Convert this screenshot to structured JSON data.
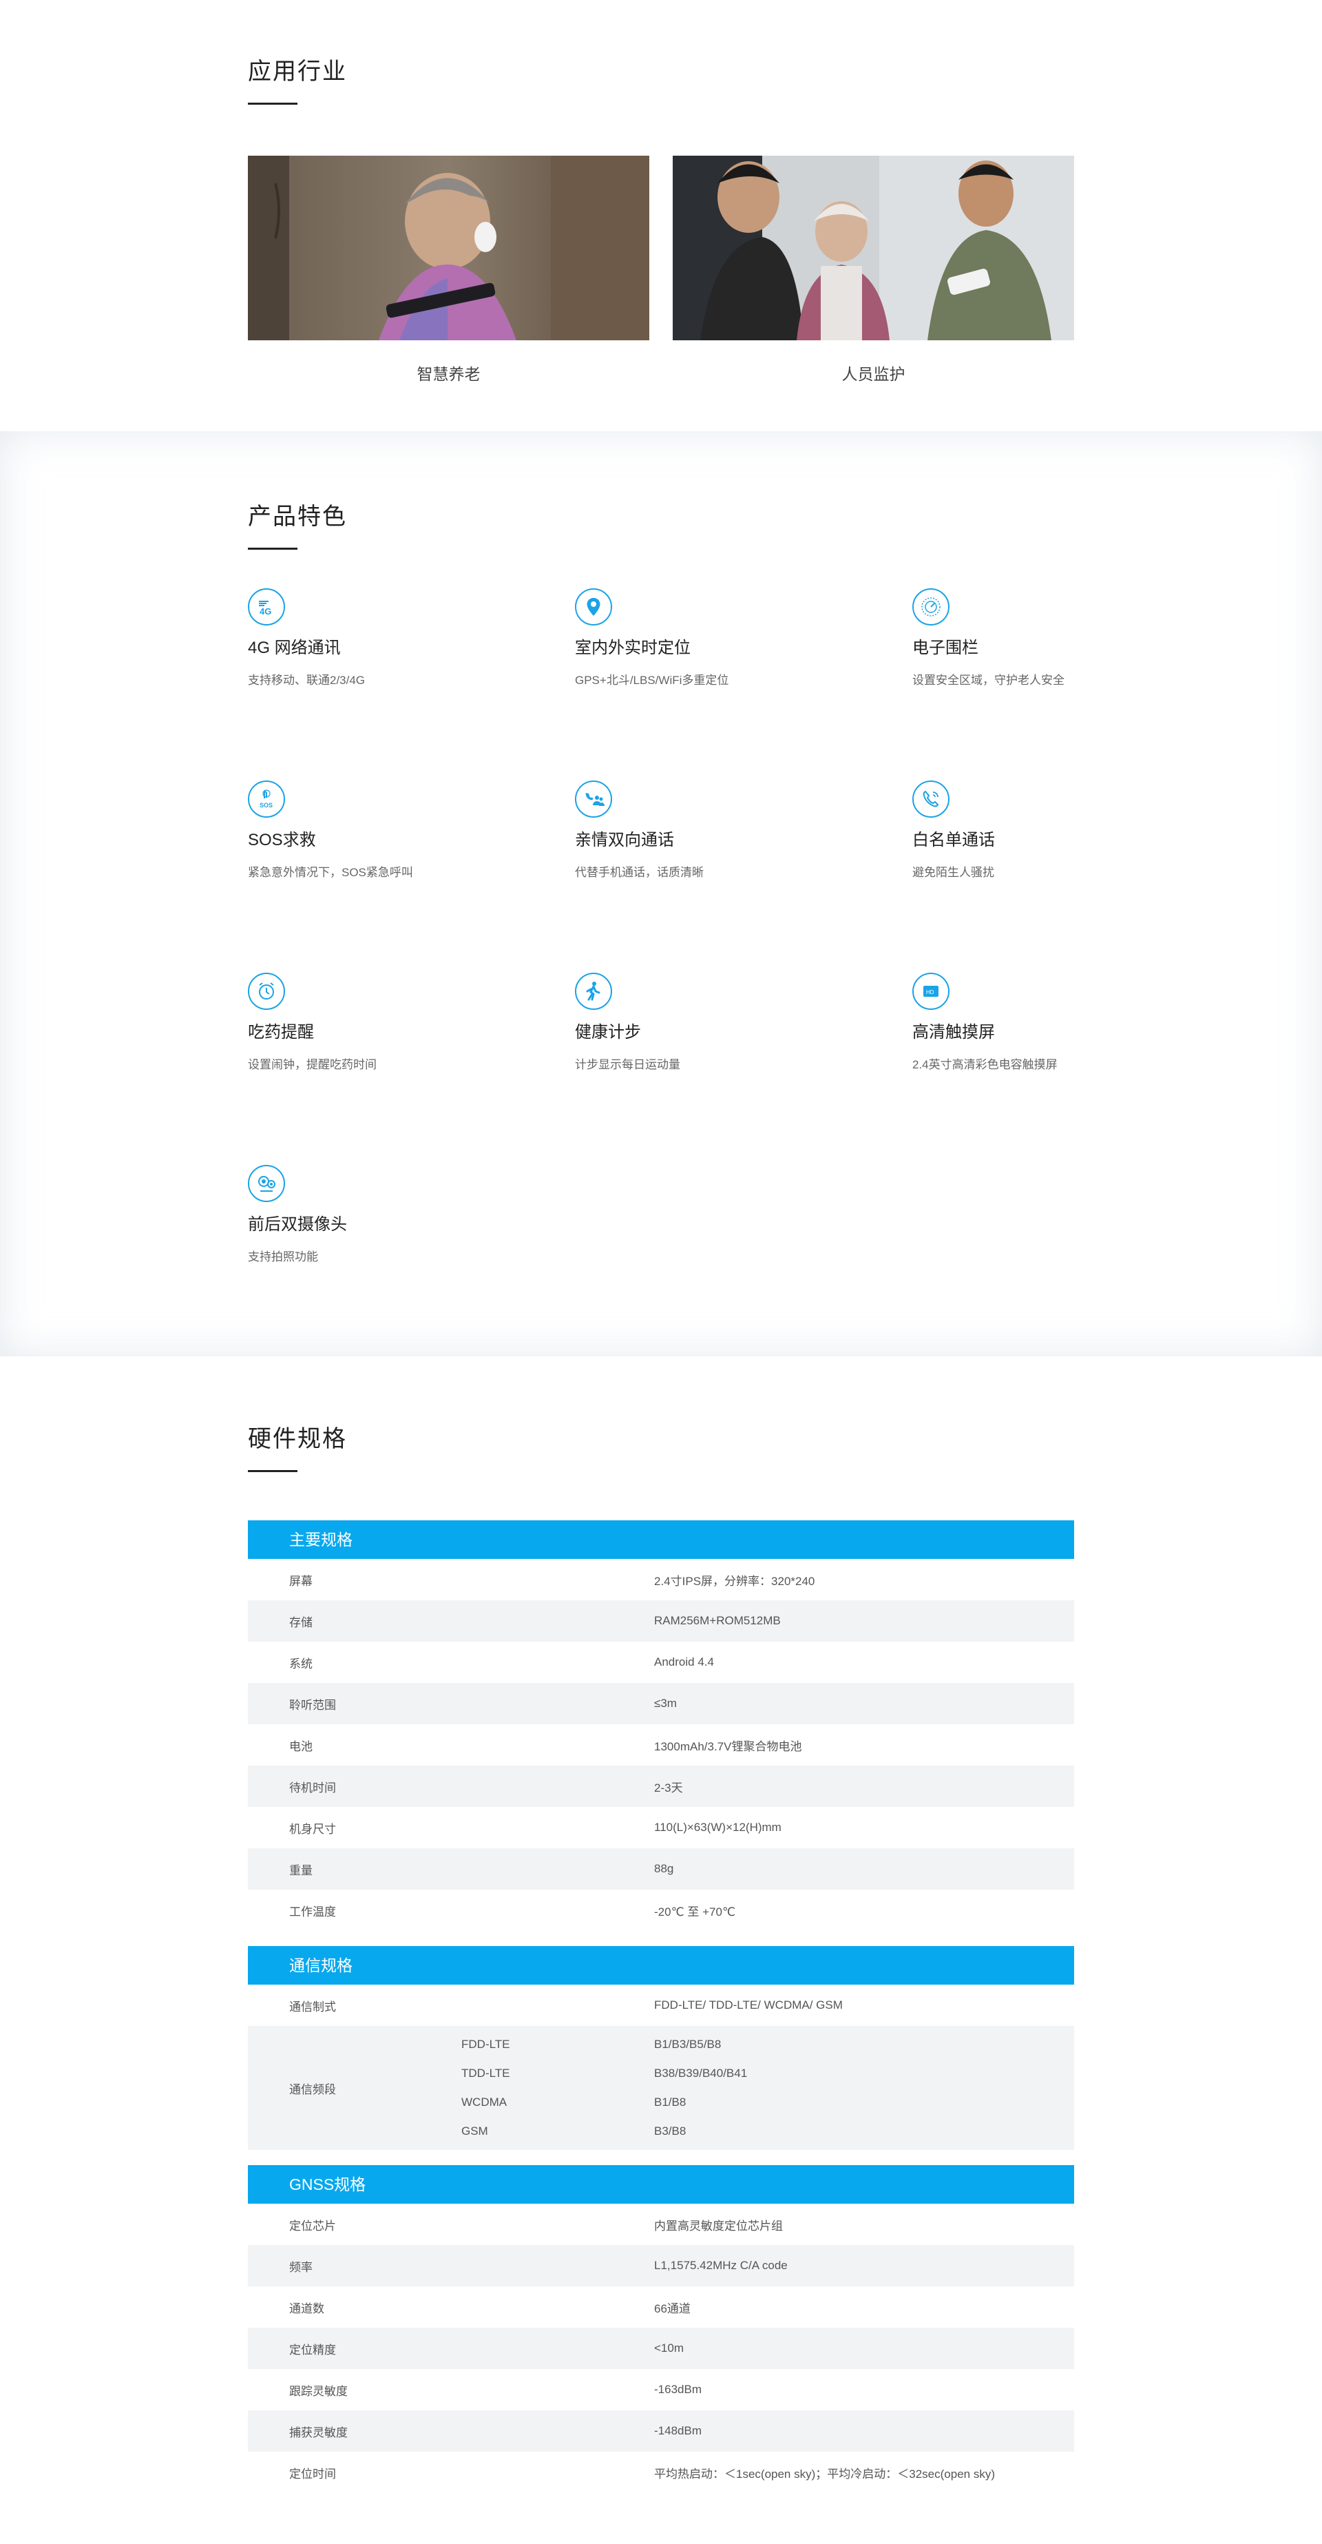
{
  "industry": {
    "title": "应用行业",
    "cards": [
      {
        "caption": "智慧养老"
      },
      {
        "caption": "人员监护"
      }
    ]
  },
  "features": {
    "title": "产品特色",
    "items": [
      {
        "icon": "4g-icon",
        "title": "4G 网络通讯",
        "desc": "支持移动、联通2/3/4G"
      },
      {
        "icon": "location-pin-icon",
        "title": "室内外实时定位",
        "desc": "GPS+北斗/LBS/WiFi多重定位"
      },
      {
        "icon": "geofence-icon",
        "title": "电子围栏",
        "desc": "设置安全区域，守护老人安全"
      },
      {
        "icon": "sos-icon",
        "title": "SOS求救",
        "desc": "紧急意外情况下，SOS紧急呼叫"
      },
      {
        "icon": "family-call-icon",
        "title": "亲情双向通话",
        "desc": "代替手机通话，话质清晰"
      },
      {
        "icon": "phone-icon",
        "title": "白名单通话",
        "desc": "避免陌生人骚扰"
      },
      {
        "icon": "alarm-clock-icon",
        "title": "吃药提醒",
        "desc": "设置闹钟，提醒吃药时间"
      },
      {
        "icon": "walking-icon",
        "title": "健康计步",
        "desc": "计步显示每日运动量"
      },
      {
        "icon": "hd-screen-icon",
        "title": "高清触摸屏",
        "desc": "2.4英寸高清彩色电容触摸屏"
      },
      {
        "icon": "dual-camera-icon",
        "title": "前后双摄像头",
        "desc": "支持拍照功能"
      }
    ],
    "icon_color": "#1aa3e6"
  },
  "hardware": {
    "title": "硬件规格",
    "accent": "#08a8ee",
    "main": {
      "header": "主要规格",
      "rows": [
        {
          "k": "屏幕",
          "v": "2.4寸IPS屏，分辨率：320*240"
        },
        {
          "k": "存储",
          "v": "RAM256M+ROM512MB"
        },
        {
          "k": "系统",
          "v": "Android 4.4"
        },
        {
          "k": "聆听范围",
          "v": "≤3m"
        },
        {
          "k": "电池",
          "v": "1300mAh/3.7V锂聚合物电池"
        },
        {
          "k": "待机时间",
          "v": "2-3天"
        },
        {
          "k": "机身尺寸",
          "v": "110(L)×63(W)×12(H)mm"
        },
        {
          "k": "重量",
          "v": "88g"
        },
        {
          "k": "工作温度",
          "v": "-20℃ 至 +70℃"
        }
      ]
    },
    "comm": {
      "header": "通信规格",
      "mode": {
        "k": "通信制式",
        "v": "FDD-LTE/ TDD-LTE/ WCDMA/ GSM"
      },
      "band": {
        "k": "通信频段",
        "rows": [
          {
            "sub": "FDD-LTE",
            "v": "B1/B3/B5/B8"
          },
          {
            "sub": "TDD-LTE",
            "v": "B38/B39/B40/B41"
          },
          {
            "sub": "WCDMA",
            "v": "B1/B8"
          },
          {
            "sub": "GSM",
            "v": "B3/B8"
          }
        ]
      }
    },
    "gnss": {
      "header": "GNSS规格",
      "rows": [
        {
          "k": "定位芯片",
          "v": "内置高灵敏度定位芯片组"
        },
        {
          "k": "频率",
          "v": "L1,1575.42MHz C/A code"
        },
        {
          "k": "通道数",
          "v": "66通道"
        },
        {
          "k": "定位精度",
          "v": "<10m"
        },
        {
          "k": "跟踪灵敏度",
          "v": "-163dBm"
        },
        {
          "k": "捕获灵敏度",
          "v": "-148dBm"
        },
        {
          "k": "定位时间",
          "v": "平均热启动：＜1sec(open sky)；平均冷启动：＜32sec(open sky)"
        }
      ]
    }
  }
}
